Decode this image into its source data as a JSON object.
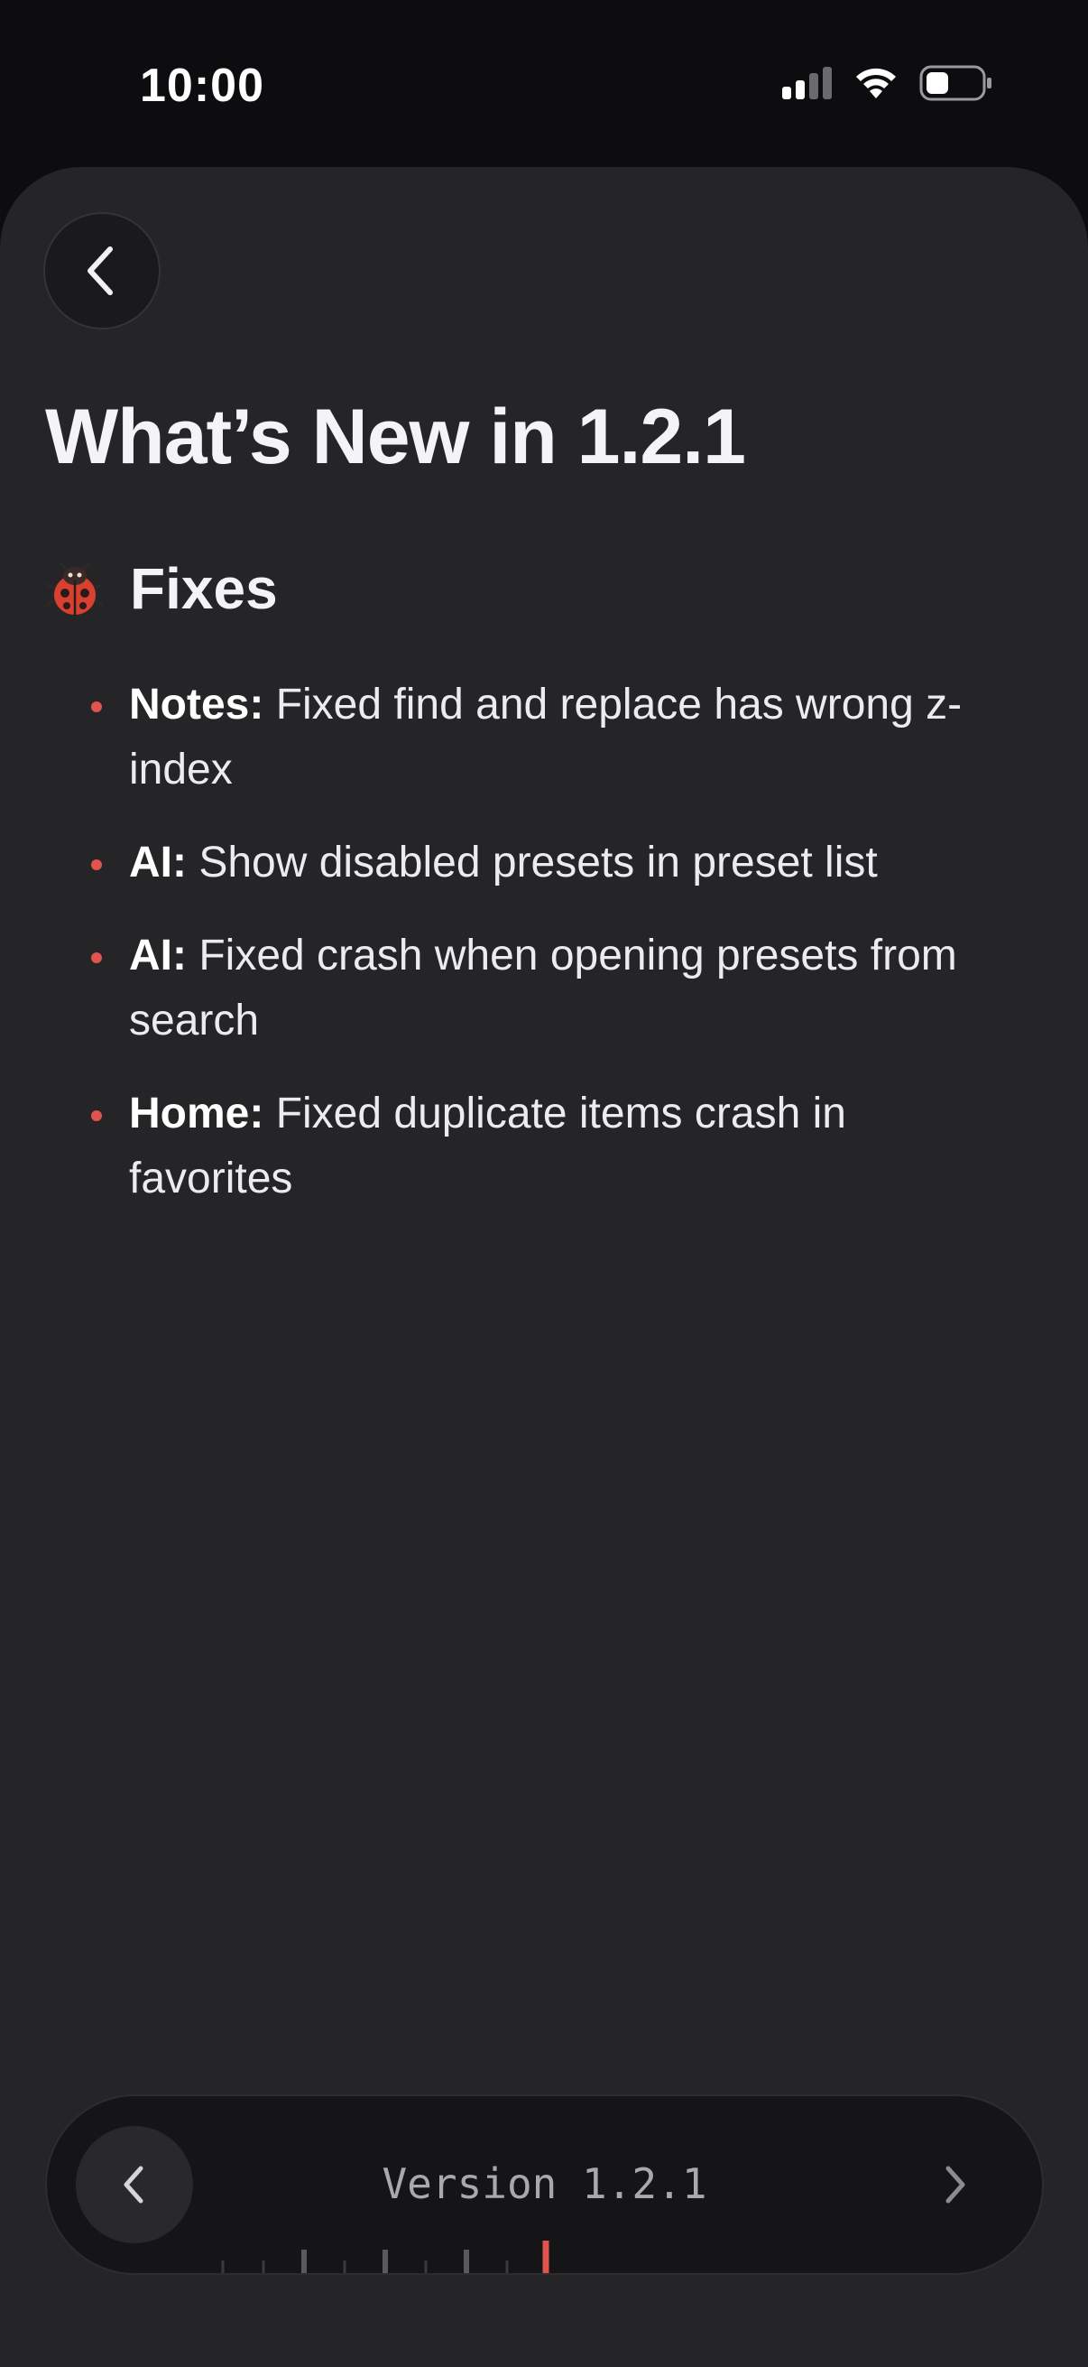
{
  "status_bar": {
    "time": "10:00",
    "icons": [
      "cellular-signal-icon",
      "wifi-icon",
      "battery-icon"
    ]
  },
  "header": {
    "back_icon": "chevron-left-icon",
    "title": "What’s New in 1.2.1"
  },
  "section": {
    "icon": "ladybug-icon",
    "title": "Fixes",
    "items": [
      {
        "area": "Notes:",
        "text": "Fixed find and replace has wrong z-index"
      },
      {
        "area": "AI:",
        "text": "Show disabled presets in preset list"
      },
      {
        "area": "AI:",
        "text": "Fixed crash when opening presets from search"
      },
      {
        "area": "Home:",
        "text": "Fixed duplicate items crash in favorites"
      }
    ]
  },
  "version_picker": {
    "label": "Version 1.2.1",
    "prev_icon": "chevron-left-icon",
    "next_icon": "chevron-right-icon",
    "accent_color": "#e0544f"
  },
  "colors": {
    "background": "#252528",
    "bullet": "#e0544f"
  }
}
